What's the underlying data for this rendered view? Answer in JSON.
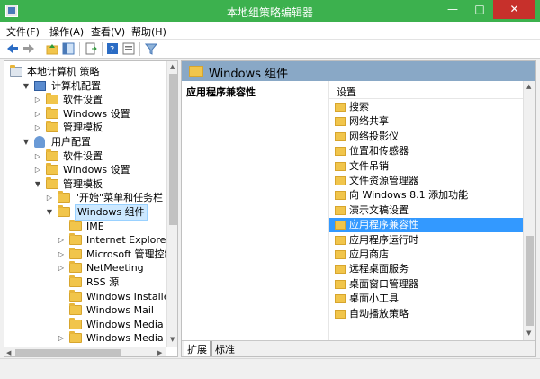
{
  "window": {
    "title": "本地组策略编辑器",
    "min": "—",
    "max": "□",
    "close": "✕"
  },
  "menu": [
    "文件(F)",
    "操作(A)",
    "查看(V)",
    "帮助(H)"
  ],
  "tree": [
    {
      "label": "本地计算机 策略",
      "indent": 0,
      "icon": "policy",
      "exp": ""
    },
    {
      "label": "计算机配置",
      "indent": 1,
      "icon": "pc",
      "exp": "▼"
    },
    {
      "label": "软件设置",
      "indent": 2,
      "icon": "folder",
      "exp": "▷"
    },
    {
      "label": "Windows 设置",
      "indent": 2,
      "icon": "folder",
      "exp": "▷"
    },
    {
      "label": "管理模板",
      "indent": 2,
      "icon": "folder",
      "exp": "▷"
    },
    {
      "label": "用户配置",
      "indent": 1,
      "icon": "user",
      "exp": "▼"
    },
    {
      "label": "软件设置",
      "indent": 2,
      "icon": "folder",
      "exp": "▷"
    },
    {
      "label": "Windows 设置",
      "indent": 2,
      "icon": "folder",
      "exp": "▷"
    },
    {
      "label": "管理模板",
      "indent": 2,
      "icon": "folder",
      "exp": "▼"
    },
    {
      "label": "\"开始\"菜单和任务栏",
      "indent": 3,
      "icon": "folder",
      "exp": "▷"
    },
    {
      "label": "Windows 组件",
      "indent": 3,
      "icon": "folder",
      "exp": "▼",
      "selected": true
    },
    {
      "label": "IME",
      "indent": 4,
      "icon": "folder",
      "exp": ""
    },
    {
      "label": "Internet Explorer",
      "indent": 4,
      "icon": "folder",
      "exp": "▷"
    },
    {
      "label": "Microsoft 管理控制台",
      "indent": 4,
      "icon": "folder",
      "exp": "▷"
    },
    {
      "label": "NetMeeting",
      "indent": 4,
      "icon": "folder",
      "exp": "▷"
    },
    {
      "label": "RSS 源",
      "indent": 4,
      "icon": "folder",
      "exp": ""
    },
    {
      "label": "Windows Installer",
      "indent": 4,
      "icon": "folder",
      "exp": ""
    },
    {
      "label": "Windows Mail",
      "indent": 4,
      "icon": "folder",
      "exp": ""
    },
    {
      "label": "Windows Media Cent",
      "indent": 4,
      "icon": "folder",
      "exp": ""
    },
    {
      "label": "Windows Media Playe",
      "indent": 4,
      "icon": "folder",
      "exp": "▷"
    }
  ],
  "right": {
    "header": "Windows 组件",
    "desc_title": "应用程序兼容性",
    "column": "设置",
    "items": [
      "搜索",
      "网络共享",
      "网络投影仪",
      "位置和传感器",
      "文件吊销",
      "文件资源管理器",
      "向 Windows 8.1 添加功能",
      "演示文稿设置",
      "应用程序兼容性",
      "应用程序运行时",
      "应用商店",
      "远程桌面服务",
      "桌面窗口管理器",
      "桌面小工具",
      "自动播放策略"
    ],
    "selected_index": 8
  },
  "tabs": [
    "扩展",
    "标准"
  ]
}
